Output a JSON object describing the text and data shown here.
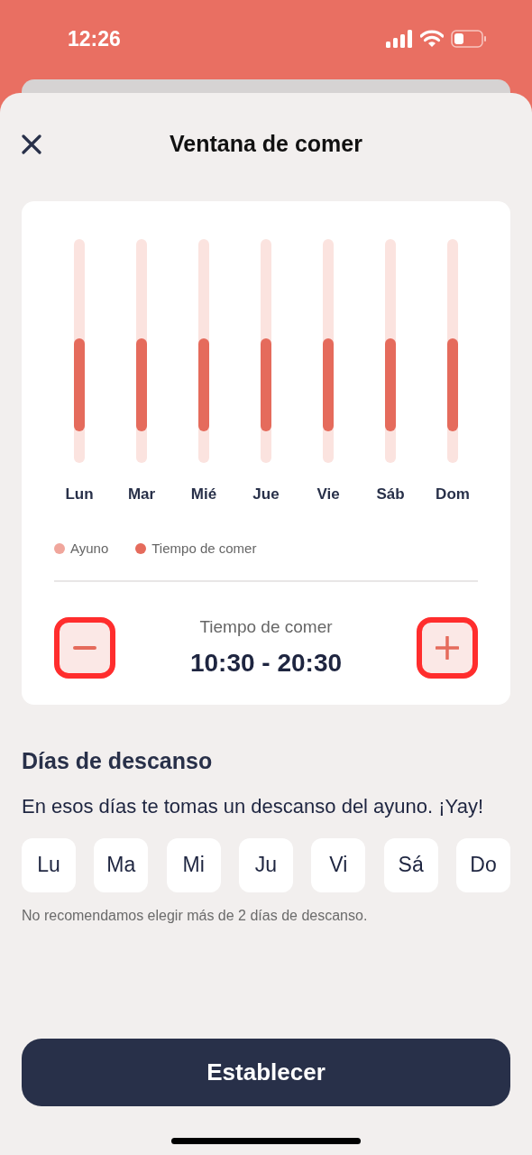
{
  "status_bar": {
    "time": "12:26"
  },
  "header": {
    "title": "Ventana de comer"
  },
  "week_chart": {
    "days": [
      {
        "label": "Lun"
      },
      {
        "label": "Mar"
      },
      {
        "label": "Mié"
      },
      {
        "label": "Jue"
      },
      {
        "label": "Vie"
      },
      {
        "label": "Sáb"
      },
      {
        "label": "Dom"
      }
    ]
  },
  "legend": [
    {
      "label": "Ayuno",
      "color": "#f0a69c"
    },
    {
      "label": "Tiempo de comer",
      "color": "#e56b5c"
    }
  ],
  "eating_time": {
    "label": "Tiempo de comer",
    "range": "10:30 - 20:30",
    "decrease_highlighted": true,
    "increase_highlighted": true
  },
  "rest_days": {
    "title": "Días de descanso",
    "description": "En esos días te tomas un descanso del ayuno. ¡Yay!",
    "days": [
      {
        "label": "Lu",
        "selected": false
      },
      {
        "label": "Ma",
        "selected": false
      },
      {
        "label": "Mi",
        "selected": false
      },
      {
        "label": "Ju",
        "selected": false
      },
      {
        "label": "Vi",
        "selected": false
      },
      {
        "label": "Sá",
        "selected": false
      },
      {
        "label": "Do",
        "selected": false
      }
    ],
    "note": "No recomendamos elegir más de 2 días de descanso."
  },
  "primary_button": "Establecer"
}
